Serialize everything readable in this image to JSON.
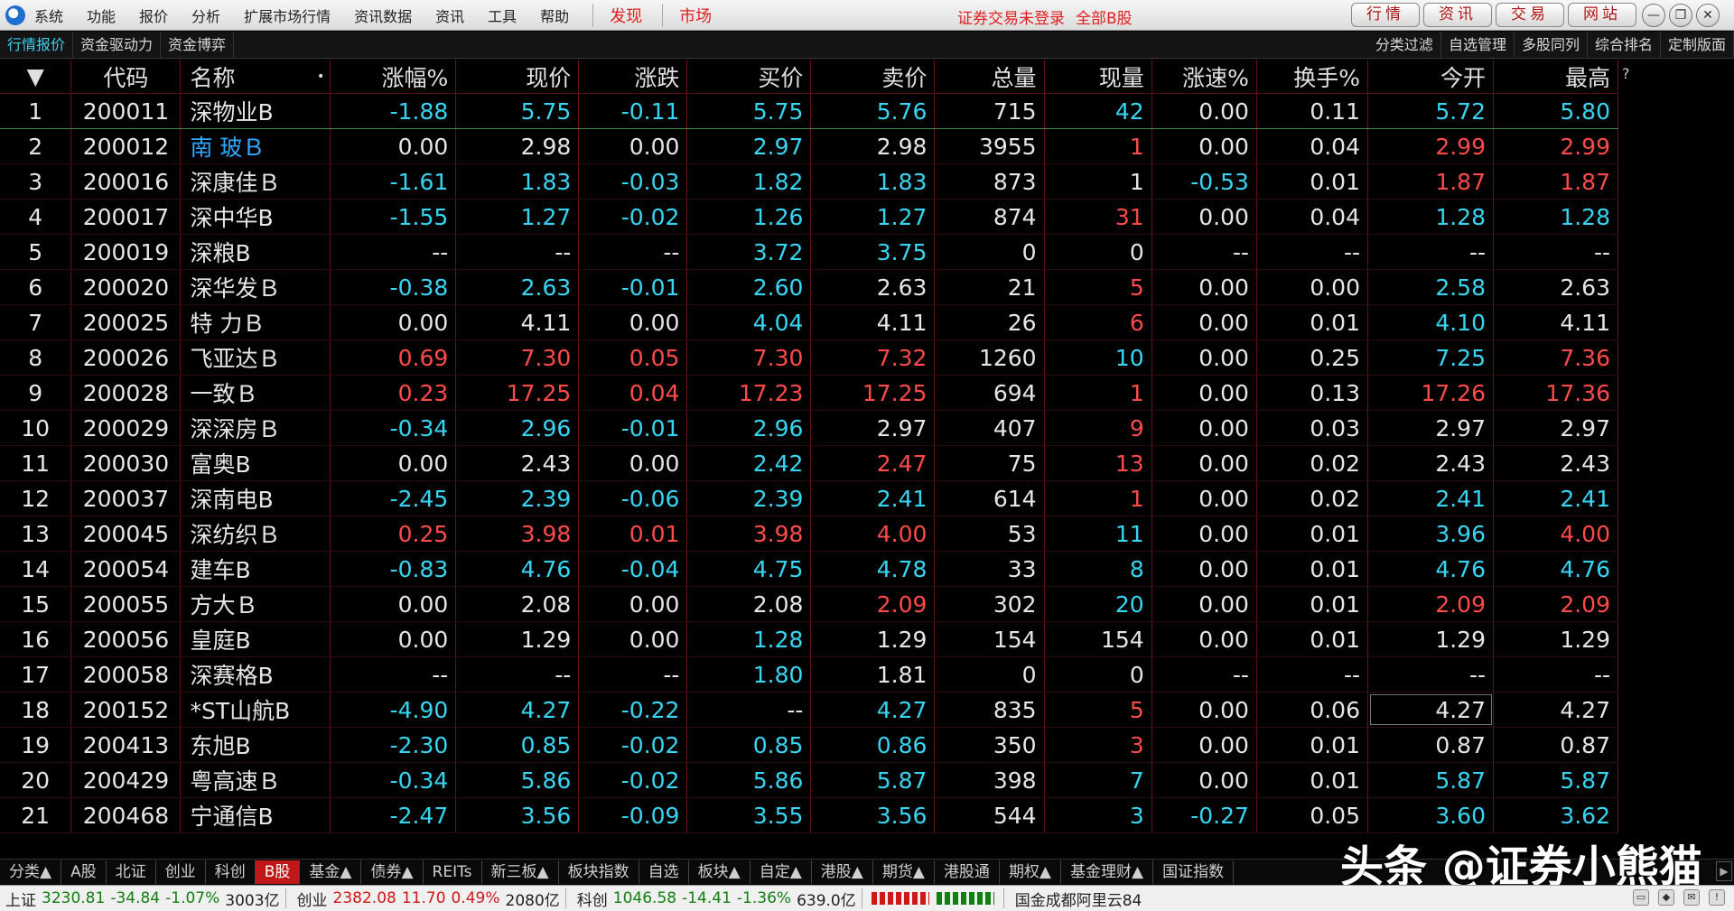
{
  "menubar": {
    "items": [
      "系统",
      "功能",
      "报价",
      "分析",
      "扩展市场行情",
      "资讯数据",
      "资讯",
      "工具",
      "帮助"
    ],
    "red_items": [
      "发现",
      "市场"
    ],
    "login_status": "证券交易未登录",
    "board_title": "全部B股",
    "top_buttons": [
      "行情",
      "资讯",
      "交易",
      "网站"
    ],
    "window_controls": [
      "—",
      "❐",
      "✕"
    ]
  },
  "subbar": {
    "left_tabs": [
      "行情报价",
      "资金驱动力",
      "资金博弈"
    ],
    "right_tabs": [
      "分类过滤",
      "自选管理",
      "多股同列",
      "综合排名",
      "定制版面"
    ]
  },
  "table": {
    "headers": [
      "",
      "代码",
      "名称",
      "涨幅%",
      "现价",
      "涨跌",
      "买价",
      "卖价",
      "总量",
      "现量",
      "涨速%",
      "换手%",
      "今开",
      "最高"
    ],
    "sort_icon": "▼",
    "name_dot": "•",
    "help_mark": "?",
    "rows": [
      [
        "1",
        "200011",
        "深物业B",
        "-1.88",
        "5.75",
        "-0.11",
        "5.75",
        "5.76",
        "715",
        "42",
        "0.00",
        "0.11",
        "5.72",
        "5.80"
      ],
      [
        "2",
        "200012",
        "南 玻Ｂ",
        "0.00",
        "2.98",
        "0.00",
        "2.97",
        "2.98",
        "3955",
        "1",
        "0.00",
        "0.04",
        "2.99",
        "2.99"
      ],
      [
        "3",
        "200016",
        "深康佳Ｂ",
        "-1.61",
        "1.83",
        "-0.03",
        "1.82",
        "1.83",
        "873",
        "1",
        "-0.53",
        "0.01",
        "1.87",
        "1.87"
      ],
      [
        "4",
        "200017",
        "深中华B",
        "-1.55",
        "1.27",
        "-0.02",
        "1.26",
        "1.27",
        "874",
        "31",
        "0.00",
        "0.04",
        "1.28",
        "1.28"
      ],
      [
        "5",
        "200019",
        "深粮B",
        "--",
        "--",
        "--",
        "3.72",
        "3.75",
        "0",
        "0",
        "--",
        "--",
        "--",
        "--"
      ],
      [
        "6",
        "200020",
        "深华发Ｂ",
        "-0.38",
        "2.63",
        "-0.01",
        "2.60",
        "2.63",
        "21",
        "5",
        "0.00",
        "0.00",
        "2.58",
        "2.63"
      ],
      [
        "7",
        "200025",
        "特 力Ｂ",
        "0.00",
        "4.11",
        "0.00",
        "4.04",
        "4.11",
        "26",
        "6",
        "0.00",
        "0.01",
        "4.10",
        "4.11"
      ],
      [
        "8",
        "200026",
        "飞亚达Ｂ",
        "0.69",
        "7.30",
        "0.05",
        "7.30",
        "7.32",
        "1260",
        "10",
        "0.00",
        "0.25",
        "7.25",
        "7.36"
      ],
      [
        "9",
        "200028",
        "一致Ｂ",
        "0.23",
        "17.25",
        "0.04",
        "17.23",
        "17.25",
        "694",
        "1",
        "0.00",
        "0.13",
        "17.26",
        "17.36"
      ],
      [
        "10",
        "200029",
        "深深房Ｂ",
        "-0.34",
        "2.96",
        "-0.01",
        "2.96",
        "2.97",
        "407",
        "9",
        "0.00",
        "0.03",
        "2.97",
        "2.97"
      ],
      [
        "11",
        "200030",
        "富奥B",
        "0.00",
        "2.43",
        "0.00",
        "2.42",
        "2.47",
        "75",
        "13",
        "0.00",
        "0.02",
        "2.43",
        "2.43"
      ],
      [
        "12",
        "200037",
        "深南电B",
        "-2.45",
        "2.39",
        "-0.06",
        "2.39",
        "2.41",
        "614",
        "1",
        "0.00",
        "0.02",
        "2.41",
        "2.41"
      ],
      [
        "13",
        "200045",
        "深纺织Ｂ",
        "0.25",
        "3.98",
        "0.01",
        "3.98",
        "4.00",
        "53",
        "11",
        "0.00",
        "0.01",
        "3.96",
        "4.00"
      ],
      [
        "14",
        "200054",
        "建车B",
        "-0.83",
        "4.76",
        "-0.04",
        "4.75",
        "4.78",
        "33",
        "8",
        "0.00",
        "0.01",
        "4.76",
        "4.76"
      ],
      [
        "15",
        "200055",
        "方大Ｂ",
        "0.00",
        "2.08",
        "0.00",
        "2.08",
        "2.09",
        "302",
        "20",
        "0.00",
        "0.01",
        "2.09",
        "2.09"
      ],
      [
        "16",
        "200056",
        "皇庭B",
        "0.00",
        "1.29",
        "0.00",
        "1.28",
        "1.29",
        "154",
        "154",
        "0.00",
        "0.01",
        "1.29",
        "1.29"
      ],
      [
        "17",
        "200058",
        "深赛格B",
        "--",
        "--",
        "--",
        "1.80",
        "1.81",
        "0",
        "0",
        "--",
        "--",
        "--",
        "--"
      ],
      [
        "18",
        "200152",
        "*ST山航B",
        "-4.90",
        "4.27",
        "-0.22",
        "--",
        "4.27",
        "835",
        "5",
        "0.00",
        "0.06",
        "4.27",
        "4.27"
      ],
      [
        "19",
        "200413",
        "东旭B",
        "-2.30",
        "0.85",
        "-0.02",
        "0.85",
        "0.86",
        "350",
        "3",
        "0.00",
        "0.01",
        "0.87",
        "0.87"
      ],
      [
        "20",
        "200429",
        "粤高速Ｂ",
        "-0.34",
        "5.86",
        "-0.02",
        "5.86",
        "5.87",
        "398",
        "7",
        "0.00",
        "0.01",
        "5.87",
        "5.87"
      ],
      [
        "21",
        "200468",
        "宁通信B",
        "-2.47",
        "3.56",
        "-0.09",
        "3.55",
        "3.56",
        "544",
        "3",
        "-0.27",
        "0.05",
        "3.60",
        "3.62"
      ]
    ],
    "colors": [
      [
        "e",
        "e",
        "e",
        "d",
        "d",
        "d",
        "d",
        "d",
        "e",
        "d",
        "e",
        "e",
        "d",
        "d"
      ],
      [
        "e",
        "e",
        "n",
        "e",
        "e",
        "e",
        "d",
        "e",
        "e",
        "u",
        "e",
        "e",
        "u",
        "u"
      ],
      [
        "e",
        "e",
        "e",
        "d",
        "d",
        "d",
        "d",
        "d",
        "e",
        "e",
        "d",
        "e",
        "u",
        "u"
      ],
      [
        "e",
        "e",
        "e",
        "d",
        "d",
        "d",
        "d",
        "d",
        "e",
        "u",
        "e",
        "e",
        "d",
        "d"
      ],
      [
        "e",
        "e",
        "e",
        "e",
        "e",
        "e",
        "d",
        "d",
        "e",
        "e",
        "e",
        "e",
        "e",
        "e"
      ],
      [
        "e",
        "e",
        "e",
        "d",
        "d",
        "d",
        "d",
        "e",
        "e",
        "u",
        "e",
        "e",
        "d",
        "e"
      ],
      [
        "e",
        "e",
        "e",
        "e",
        "e",
        "e",
        "d",
        "e",
        "e",
        "u",
        "e",
        "e",
        "d",
        "e"
      ],
      [
        "e",
        "e",
        "e",
        "u",
        "u",
        "u",
        "u",
        "u",
        "e",
        "d",
        "e",
        "e",
        "d",
        "u"
      ],
      [
        "e",
        "e",
        "e",
        "u",
        "u",
        "u",
        "u",
        "u",
        "e",
        "u",
        "e",
        "e",
        "u",
        "u"
      ],
      [
        "e",
        "e",
        "e",
        "d",
        "d",
        "d",
        "d",
        "e",
        "e",
        "u",
        "e",
        "e",
        "e",
        "e"
      ],
      [
        "e",
        "e",
        "e",
        "e",
        "e",
        "e",
        "d",
        "u",
        "e",
        "u",
        "e",
        "e",
        "e",
        "e"
      ],
      [
        "e",
        "e",
        "e",
        "d",
        "d",
        "d",
        "d",
        "d",
        "e",
        "u",
        "e",
        "e",
        "d",
        "d"
      ],
      [
        "e",
        "e",
        "e",
        "u",
        "u",
        "u",
        "u",
        "u",
        "e",
        "d",
        "e",
        "e",
        "d",
        "u"
      ],
      [
        "e",
        "e",
        "e",
        "d",
        "d",
        "d",
        "d",
        "d",
        "e",
        "d",
        "e",
        "e",
        "d",
        "d"
      ],
      [
        "e",
        "e",
        "e",
        "e",
        "e",
        "e",
        "e",
        "u",
        "e",
        "d",
        "e",
        "e",
        "u",
        "u"
      ],
      [
        "e",
        "e",
        "e",
        "e",
        "e",
        "e",
        "d",
        "e",
        "e",
        "e",
        "e",
        "e",
        "e",
        "e"
      ],
      [
        "e",
        "e",
        "e",
        "e",
        "e",
        "e",
        "d",
        "e",
        "e",
        "e",
        "e",
        "e",
        "e",
        "e"
      ],
      [
        "e",
        "e",
        "e",
        "d",
        "d",
        "d",
        "e",
        "d",
        "e",
        "u",
        "e",
        "e",
        "e",
        "e"
      ],
      [
        "e",
        "e",
        "e",
        "d",
        "d",
        "d",
        "d",
        "d",
        "e",
        "u",
        "e",
        "e",
        "e",
        "e"
      ],
      [
        "e",
        "e",
        "e",
        "d",
        "d",
        "d",
        "d",
        "d",
        "e",
        "d",
        "e",
        "e",
        "d",
        "d"
      ],
      [
        "e",
        "e",
        "e",
        "d",
        "d",
        "d",
        "d",
        "d",
        "e",
        "d",
        "d",
        "e",
        "d",
        "d"
      ]
    ]
  },
  "bottom_tabs": [
    "分类▲",
    "A股",
    "北证",
    "创业",
    "科创",
    "B股",
    "基金▲",
    "债券▲",
    "REITs",
    "新三板▲",
    "板块指数",
    "自选",
    "板块▲",
    "自定▲",
    "港股▲",
    "期货▲",
    "港股通",
    "期权▲",
    "基金理财▲",
    "国证指数"
  ],
  "active_bottom_tab": "B股",
  "watermark": "头条 @证券小熊猫",
  "statusbar": {
    "sh_label": "上证",
    "sh_value": "3230.81",
    "sh_change": "-34.84",
    "sh_pct": "-1.07%",
    "sh_amount": "3003亿",
    "cy_label": "创业",
    "cy_value": "2382.08",
    "cy_change": "11.70",
    "cy_pct": "0.49%",
    "cy_amount": "2080亿",
    "kc_label": "科创",
    "kc_value": "1046.58",
    "kc_change": "-14.41",
    "kc_pct": "-1.36%",
    "kc_amount": "639.0亿",
    "server": "国金成都阿里云84"
  },
  "palette": {
    "up": "#ff4a4a",
    "down": "#36d6f2",
    "flat": "#e6e6e6",
    "accent": "#2fa8ff",
    "border": "#6a1010"
  }
}
